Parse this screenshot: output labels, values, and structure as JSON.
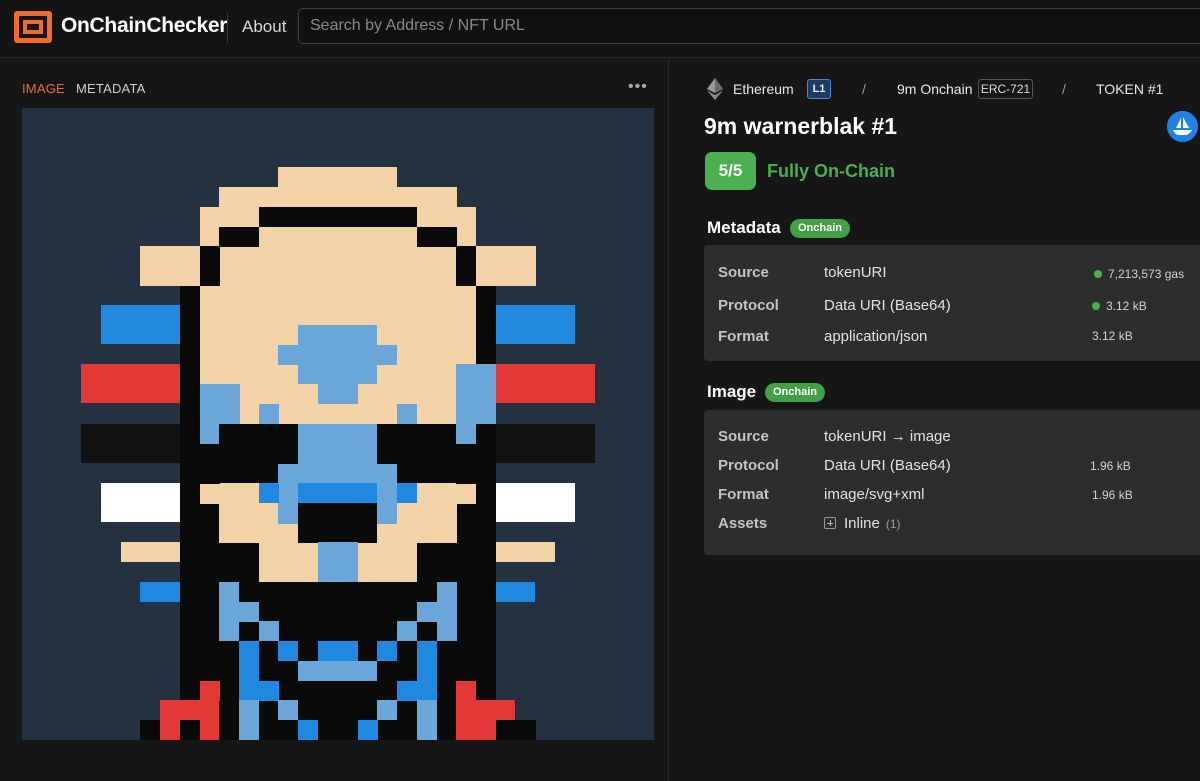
{
  "header": {
    "brand": "OnChainChecker",
    "about_label": "About",
    "search_placeholder": "Search by Address / NFT URL"
  },
  "viewer": {
    "tabs": [
      {
        "label": "IMAGE",
        "active": true
      },
      {
        "label": "METADATA",
        "active": false
      }
    ],
    "more_label": "•••"
  },
  "breadcrumb": {
    "chain": "Ethereum",
    "chain_badge": "L1",
    "collection": "9m Onchain",
    "standard_badge": "ERC-721",
    "token": "TOKEN #1",
    "separator": "/"
  },
  "token": {
    "title": "9m warnerblak #1",
    "score": "5/5",
    "score_label": "Fully On-Chain"
  },
  "metadata_section": {
    "title": "Metadata",
    "badge": "Onchain",
    "rows": [
      {
        "label": "Source",
        "value": "tokenURI",
        "stat": "7,213,573 gas",
        "dot": true
      },
      {
        "label": "Protocol",
        "value": "Data URI (Base64)",
        "stat": "3.12 kB",
        "dot": true
      },
      {
        "label": "Format",
        "value": "application/json",
        "stat": "3.12 kB",
        "dot": false
      }
    ]
  },
  "image_section": {
    "title": "Image",
    "badge": "Onchain",
    "rows": [
      {
        "label": "Source",
        "value": "tokenURI → image",
        "stat": "",
        "dot": false
      },
      {
        "label": "Protocol",
        "value": "Data URI (Base64)",
        "stat": "1.96 kB",
        "dot": false
      },
      {
        "label": "Format",
        "value": "image/svg+xml",
        "stat": "1.96 kB",
        "dot": false
      },
      {
        "label": "Assets",
        "value": "Inline",
        "count": "(1)"
      }
    ]
  },
  "colors": {
    "accent_orange": "#f26b2b",
    "success_green": "#4caf50",
    "l1_badge_blue": "#1d3a66",
    "opensea_blue": "#2081e2",
    "art_background": "#243140"
  },
  "icons": {
    "logo": "onchainchecker-logo-icon",
    "chain": "ethereum-icon",
    "marketplace": "opensea-icon",
    "expand": "plus-square-icon",
    "more": "more-dots-icon"
  }
}
